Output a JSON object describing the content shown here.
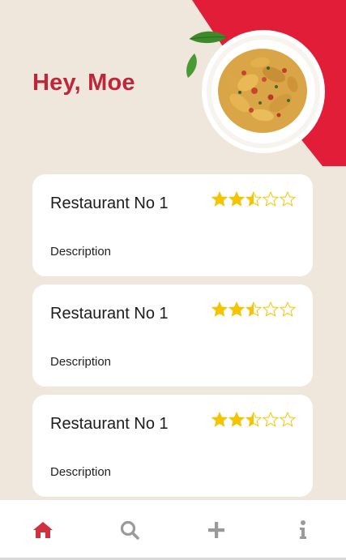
{
  "header": {
    "greeting": "Hey, Moe"
  },
  "colors": {
    "brand_red": "#e11d38",
    "greeting_red": "#c0263a",
    "background": "#efe6dc",
    "card": "#ffffff",
    "star_filled": "#f5c400",
    "tab_active": "#d0303f",
    "tab_inactive": "#9a9a9a"
  },
  "restaurants": [
    {
      "name": "Restaurant No 1",
      "description": "Description",
      "rating": 2.5,
      "rating_max": 5
    },
    {
      "name": "Restaurant No 1",
      "description": "Description",
      "rating": 2.5,
      "rating_max": 5
    },
    {
      "name": "Restaurant No 1",
      "description": "Description",
      "rating": 2.5,
      "rating_max": 5
    }
  ],
  "tabbar": {
    "items": [
      {
        "icon": "home-icon",
        "active": true
      },
      {
        "icon": "search-icon",
        "active": false
      },
      {
        "icon": "plus-icon",
        "active": false
      },
      {
        "icon": "info-icon",
        "active": false
      }
    ]
  }
}
